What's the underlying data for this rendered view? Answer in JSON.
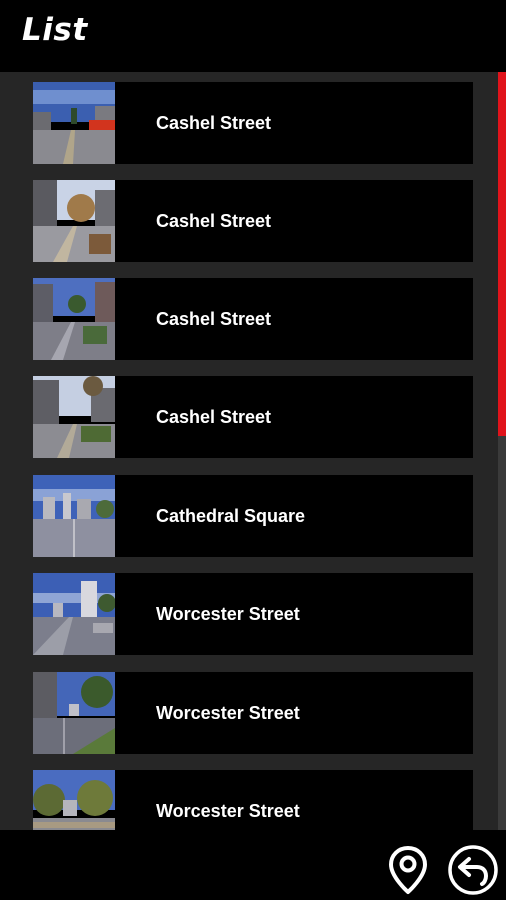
{
  "header": {
    "title": "List"
  },
  "list": {
    "items": [
      {
        "label": "Cashel Street",
        "thumb_icon": "street-photo-thumbnail"
      },
      {
        "label": "Cashel Street",
        "thumb_icon": "street-photo-thumbnail"
      },
      {
        "label": "Cashel Street",
        "thumb_icon": "street-photo-thumbnail"
      },
      {
        "label": "Cashel Street",
        "thumb_icon": "street-photo-thumbnail"
      },
      {
        "label": "Cathedral Square",
        "thumb_icon": "street-photo-thumbnail"
      },
      {
        "label": "Worcester Street",
        "thumb_icon": "street-photo-thumbnail"
      },
      {
        "label": "Worcester Street",
        "thumb_icon": "street-photo-thumbnail"
      },
      {
        "label": "Worcester Street",
        "thumb_icon": "street-photo-thumbnail"
      }
    ]
  },
  "scrollbar": {
    "visible_fraction": 0.48
  },
  "footer": {
    "map_icon": "location-pin-icon",
    "back_icon": "back-arrow-icon"
  },
  "colors": {
    "background": "#000000",
    "list_background": "#262626",
    "accent": "#e0131b",
    "text": "#ffffff"
  }
}
